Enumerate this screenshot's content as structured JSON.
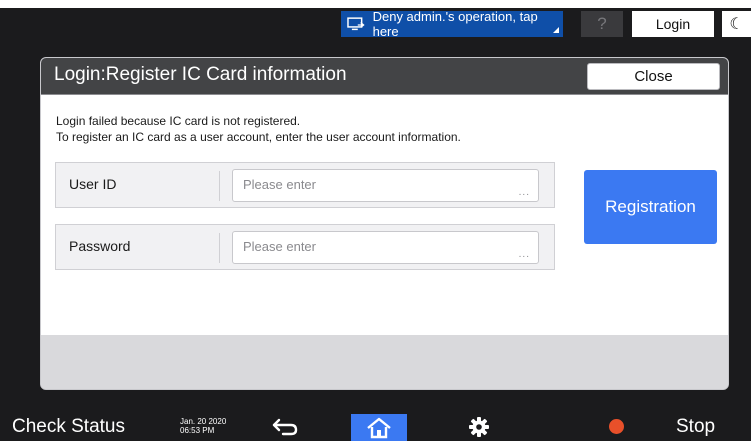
{
  "topbar": {
    "deny_label": "Deny admin.'s operation, tap here",
    "help_label": "?",
    "login_label": "Login",
    "moon_label": "☾"
  },
  "dialog": {
    "title": "Login:Register IC Card information",
    "close_label": "Close",
    "message_line1": "Login failed because IC card is not registered.",
    "message_line2": "To register an IC card as a user account, enter the user account information.",
    "fields": [
      {
        "label": "User ID",
        "placeholder": "Please enter",
        "dots": "..."
      },
      {
        "label": "Password",
        "placeholder": "Please enter",
        "dots": "..."
      }
    ],
    "register_label": "Registration"
  },
  "bottombar": {
    "check_status_label": "Check Status",
    "date": "Jan. 20 2020",
    "time": "06:53 PM",
    "stop_label": "Stop"
  },
  "icons": {
    "deny": "monitor-arrow-icon",
    "back": "back-arrow-icon",
    "home": "home-icon",
    "settings": "gear-icon",
    "stop": "stop-icon"
  },
  "colors": {
    "accent": "#3b79f2",
    "deny_button": "#0f4fa8",
    "stop": "#e8502a"
  }
}
